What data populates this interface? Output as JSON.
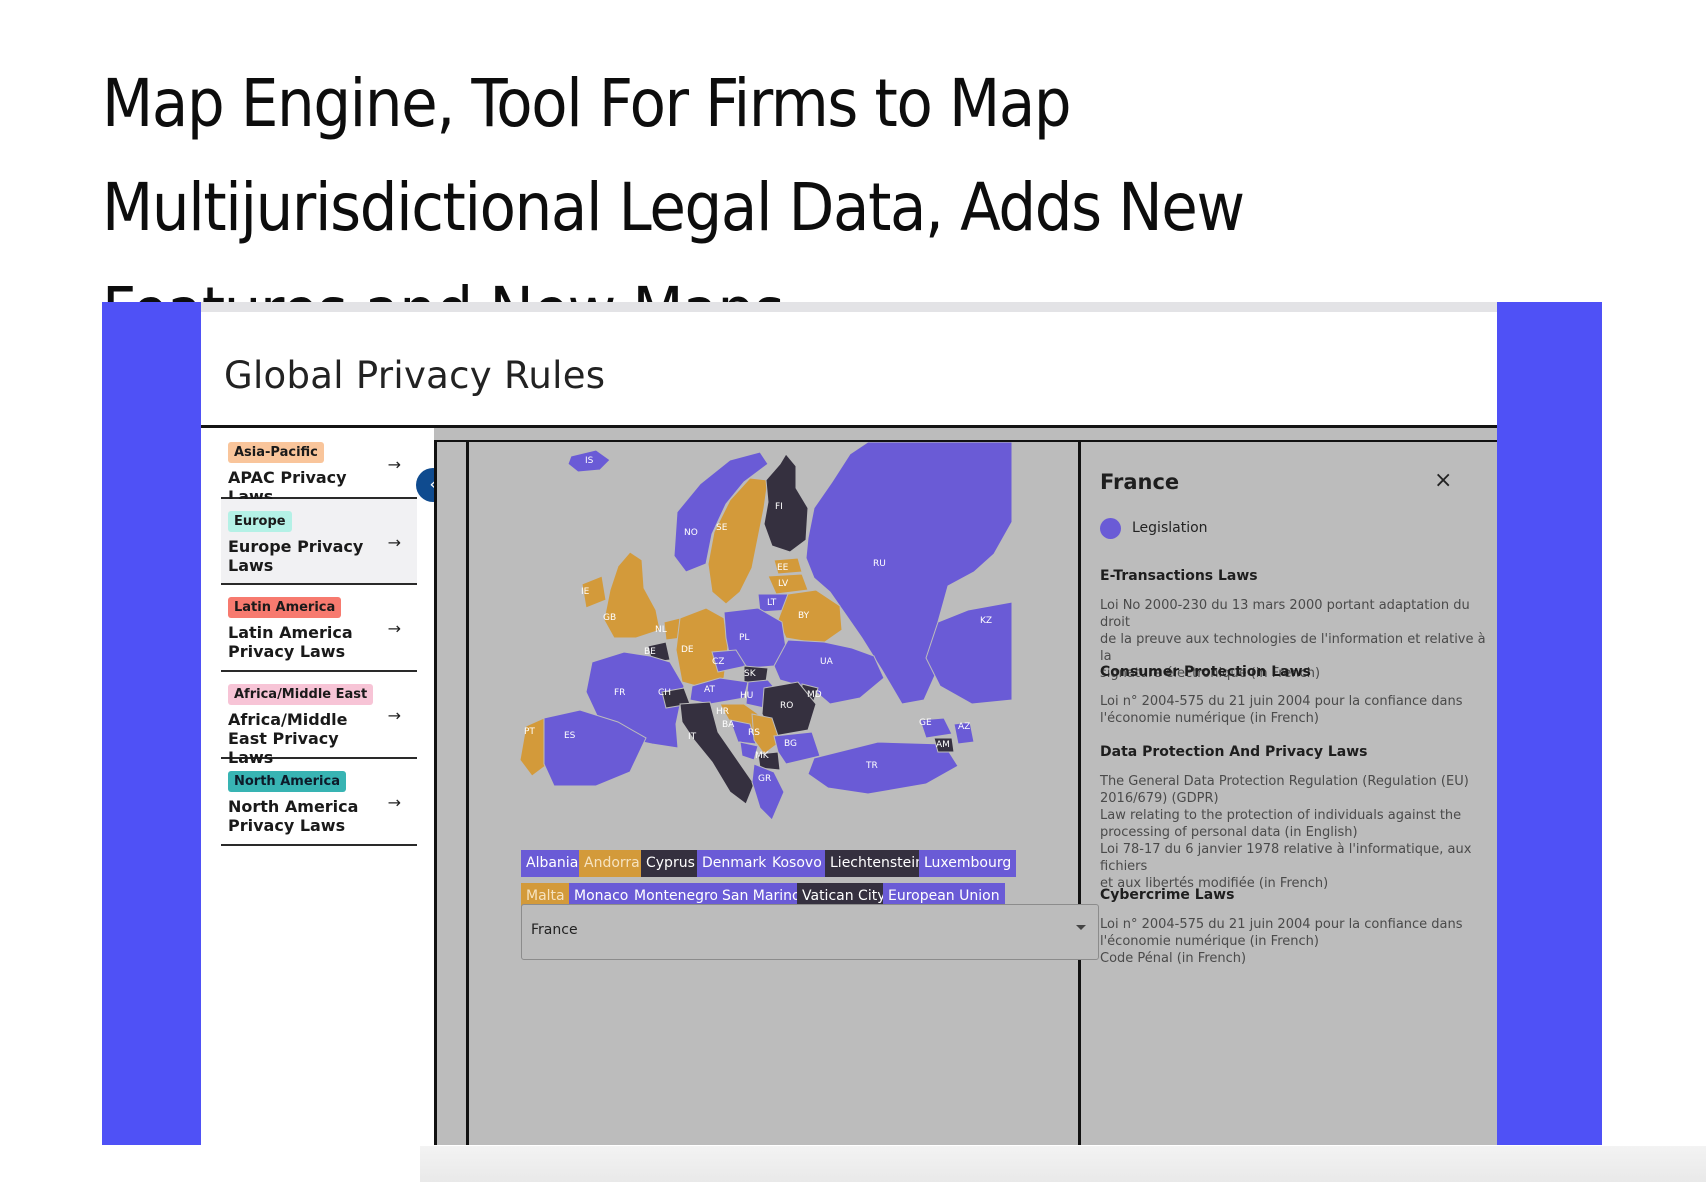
{
  "headline": "Map Engine, Tool For Firms to Map Multijurisdictional Legal Data, Adds New Features and New Maps",
  "app": {
    "title": "Global Privacy Rules"
  },
  "sidebar": {
    "items": [
      {
        "tag": "Asia-Pacific",
        "label": "APAC Privacy Laws",
        "tag_color": "#f9c59b"
      },
      {
        "tag": "Europe",
        "label": "Europe Privacy Laws",
        "tag_color": "#b4f1e6"
      },
      {
        "tag": "Latin America",
        "label": "Latin America Privacy Laws",
        "tag_color": "#f77a6f"
      },
      {
        "tag": "Africa/Middle East",
        "label": "Africa/Middle East Privacy Laws",
        "tag_color": "#f7c4d6"
      },
      {
        "tag": "North America",
        "label": "North America Privacy Laws",
        "tag_color": "#38b4b3"
      }
    ],
    "arrow": "→",
    "collapse_icon": "‹"
  },
  "map": {
    "colors": {
      "legislation": "#6a5bd6",
      "partial": "#d39a3a",
      "none": "#35303f",
      "background": "#bcbcbc"
    },
    "country_codes": [
      "IS",
      "NO",
      "SE",
      "FI",
      "RU",
      "EE",
      "LV",
      "LT",
      "BY",
      "IE",
      "GB",
      "NL",
      "DE",
      "PL",
      "UA",
      "KZ",
      "BE",
      "FR",
      "CH",
      "CZ",
      "SK",
      "AT",
      "HU",
      "MD",
      "RO",
      "PT",
      "ES",
      "IT",
      "HR",
      "BA",
      "RS",
      "ME",
      "MK",
      "BG",
      "GR",
      "TR",
      "GE",
      "AZ",
      "AM"
    ],
    "country_labels": [
      "IS",
      "NO",
      "SE",
      "FI",
      "RU",
      "EE",
      "LV",
      "LT",
      "BY",
      "IE",
      "GB",
      "NL",
      "DE",
      "PL",
      "UA",
      "KZ",
      "BE",
      "FR",
      "CH",
      "CZ",
      "SK",
      "AT",
      "HU",
      "MD",
      "RO",
      "PT",
      "ES",
      "IT",
      "HR",
      "BA",
      "RS",
      "MK",
      "BG",
      "GR",
      "TR",
      "GE",
      "AZ",
      "AM"
    ],
    "chips": [
      {
        "label": "Albania",
        "status": "legislation"
      },
      {
        "label": "Andorra",
        "status": "partial"
      },
      {
        "label": "Cyprus",
        "status": "none"
      },
      {
        "label": "Denmark",
        "status": "legislation"
      },
      {
        "label": "Kosovo",
        "status": "legislation"
      },
      {
        "label": "Liechtenstein",
        "status": "none"
      },
      {
        "label": "Luxembourg",
        "status": "legislation"
      },
      {
        "label": "Malta",
        "status": "partial"
      },
      {
        "label": "Monaco",
        "status": "legislation"
      },
      {
        "label": "Montenegro",
        "status": "legislation"
      },
      {
        "label": "San Marino",
        "status": "legislation"
      },
      {
        "label": "Vatican City",
        "status": "none"
      },
      {
        "label": "European Union",
        "status": "legislation"
      }
    ],
    "selected_country": "France"
  },
  "panel": {
    "title": "France",
    "close_icon": "×",
    "legend_label": "Legislation",
    "sections": [
      {
        "title": "E-Transactions Laws",
        "lines": [
          "Loi No 2000-230 du 13 mars 2000 portant adaptation du droit",
          "de la preuve aux technologies de l'information et relative à la",
          "signature électronique (in French)"
        ]
      },
      {
        "title": "Consumer Protection Laws",
        "lines": [
          "Loi n° 2004-575 du 21 juin 2004 pour la confiance dans",
          "l'économie numérique (in French)"
        ]
      },
      {
        "title": "Data Protection And Privacy Laws",
        "lines": [
          "The General Data Protection Regulation (Regulation (EU)",
          "2016/679) (GDPR)",
          "Law relating to the protection of individuals against the",
          "processing of personal data (in English)",
          "Loi 78-17 du 6 janvier 1978 relative à l'informatique, aux fichiers",
          "et aux libertés modifiée (in French)"
        ]
      },
      {
        "title": "Cybercrime Laws",
        "lines": [
          "Loi n° 2004-575 du 21 juin 2004 pour la confiance dans",
          "l'économie numérique (in French)",
          "Code Pénal (in French)"
        ]
      }
    ]
  }
}
